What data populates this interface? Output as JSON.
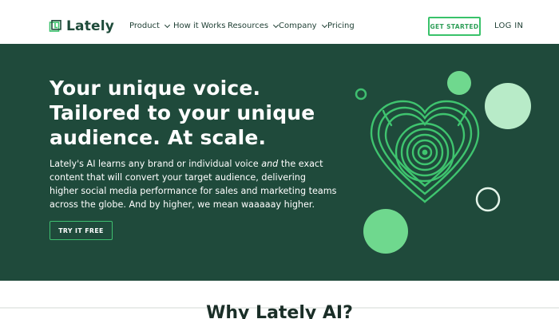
{
  "brand": {
    "name": "Lately"
  },
  "nav": {
    "items": [
      {
        "label": "Product",
        "dropdown": true
      },
      {
        "label": "How it Works",
        "dropdown": false
      },
      {
        "label": "Resources",
        "dropdown": true
      },
      {
        "label": "Company",
        "dropdown": true
      },
      {
        "label": "Pricing",
        "dropdown": false
      }
    ],
    "cta": "GET STARTED",
    "login": "LOG IN"
  },
  "hero": {
    "headline": "Your unique voice. Tailored to your unique audience. At scale.",
    "sub_before": "Lately's AI learns any brand or individual voice ",
    "sub_em": "and",
    "sub_after": " the exact content that will convert your target audience, delivering higher social media performance for sales and marketing teams across the globe. And by higher, we mean waaaaay higher.",
    "cta": "TRY IT FREE"
  },
  "below": {
    "title": "Why Lately AI?"
  },
  "colors": {
    "hero_bg": "#1f4a3b",
    "accent_green": "#39c26a",
    "light_mint": "#b8ebc8",
    "brand_dark": "#1e4b3a"
  },
  "icons": [
    "lately-logo-icon",
    "chevron-down-icon",
    "fingerprint-heart-icon"
  ]
}
